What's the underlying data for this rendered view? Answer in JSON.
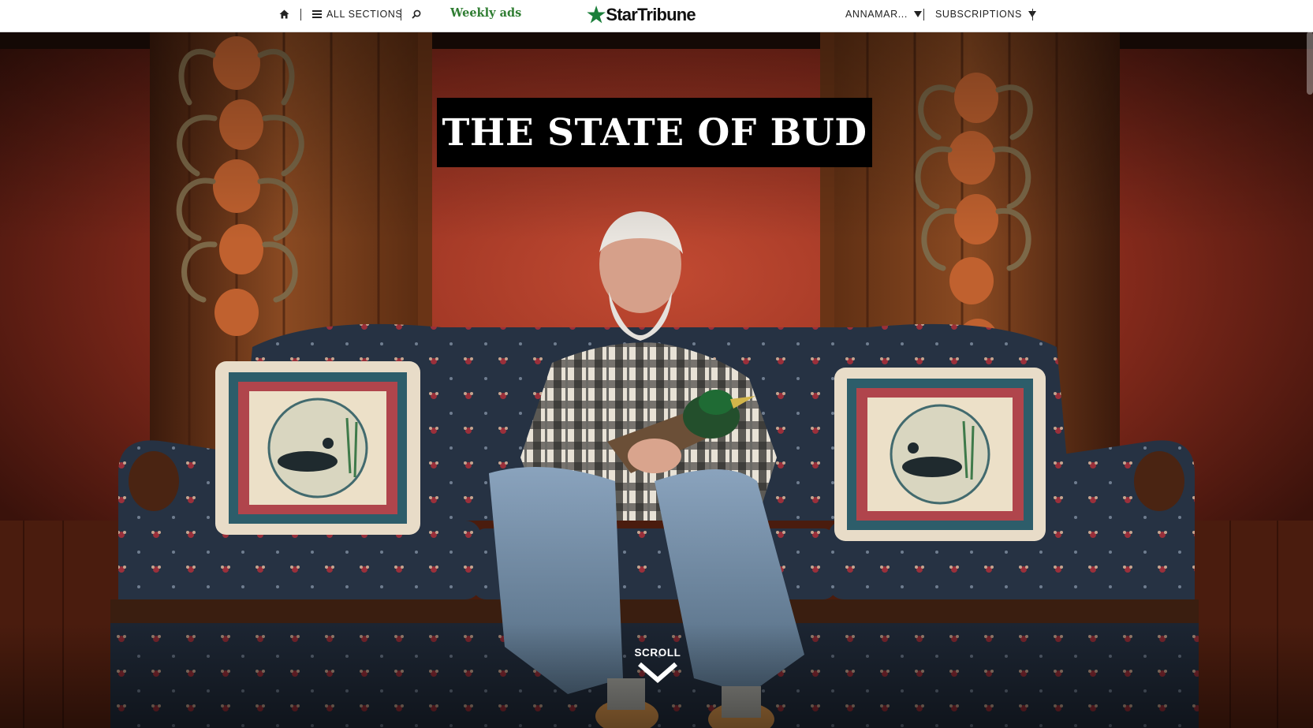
{
  "nav": {
    "home_icon": "home-icon",
    "sections_label": "ALL SECTIONS",
    "search_icon": "search-icon",
    "weekly_ads_label": "Weekly ads",
    "logo_text": "StarTribune",
    "logo_icon": "star-icon",
    "user_label": "ANNAMAR...",
    "subscriptions_label": "SUBSCRIPTIONS",
    "brand_green": "#2f7d32"
  },
  "hero": {
    "title": "THE STATE OF BUD",
    "scroll_label": "SCROLL",
    "scroll_icon": "chevron-down-icon"
  }
}
